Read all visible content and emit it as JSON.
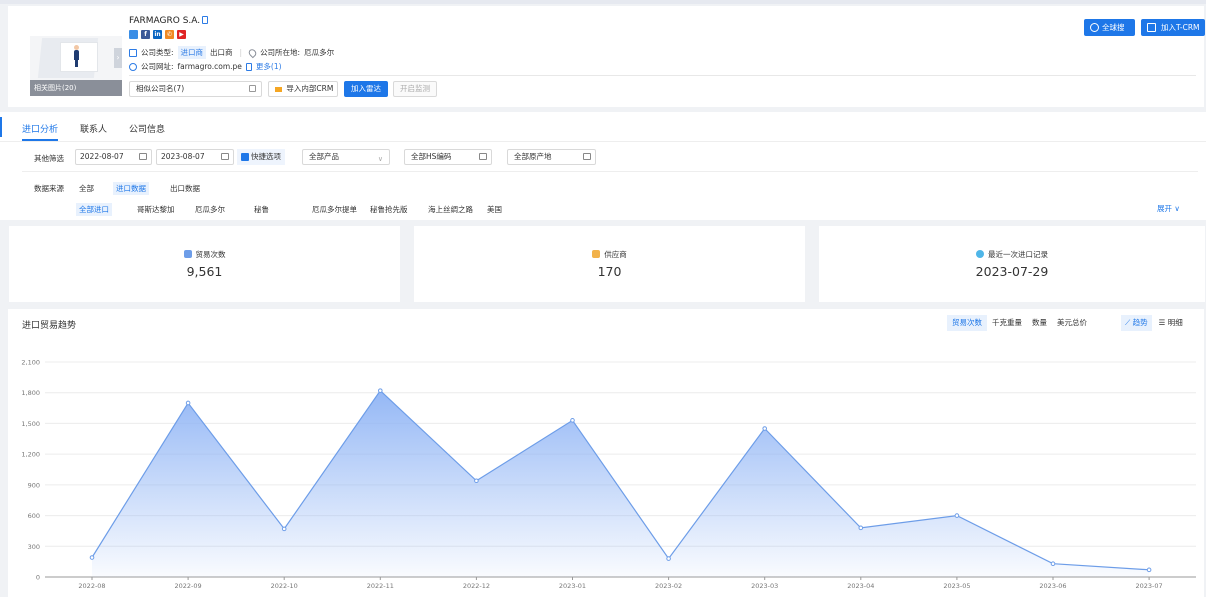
{
  "company": {
    "name": "FARMAGRO S.A.",
    "type_label": "公司类型:",
    "type_importer": "进口商",
    "type_exporter": "出口商",
    "location_label": "公司所在地:",
    "location": "厄瓜多尔",
    "website_label": "公司网址:",
    "website": "farmagro.com.pe",
    "more_link": "更多(1)",
    "pictures_label": "相关图片(20)",
    "social_icons": [
      "image-icon",
      "facebook-icon",
      "linkedin-icon",
      "phone-icon",
      "youtube-icon"
    ]
  },
  "header_actions": {
    "similar_companies": "相似公司名(7)",
    "import_crm": "导入内部CRM",
    "add_radar": "加入雷达",
    "start_monitor": "开启监测",
    "global_search": "全球搜",
    "add_tcrm": "加入T-CRM"
  },
  "tabs": [
    "进口分析",
    "联系人",
    "公司信息"
  ],
  "filters": {
    "other_label": "其他筛选",
    "date_start": "2022-08-07",
    "date_end": "2023-08-07",
    "quick_options": "快捷选项",
    "product": "全部产品",
    "hs_code": "全部HS编码",
    "origin": "全部原产地",
    "data_source_label": "数据来源",
    "sources": [
      "全部",
      "进口数据",
      "出口数据"
    ],
    "countries": [
      "全部进口",
      "哥斯达黎加",
      "厄瓜多尔",
      "秘鲁",
      "厄瓜多尔提单",
      "秘鲁抢先版",
      "海上丝绸之路",
      "美国"
    ],
    "expand": "展开"
  },
  "stats": [
    {
      "title": "贸易次数",
      "value": "9,561"
    },
    {
      "title": "供应商",
      "value": "170"
    },
    {
      "title": "最近一次进口记录",
      "value": "2023-07-29"
    }
  ],
  "chart_section": {
    "title": "进口贸易趋势",
    "metrics": [
      "贸易次数",
      "千克重量",
      "数量",
      "美元总价"
    ],
    "views": [
      "趋势",
      "明细"
    ]
  },
  "colors": {
    "accent": "#1e77e8",
    "line": "#6d9de8",
    "area_top": "#8fb4f5"
  },
  "chart_data": {
    "type": "area",
    "categories": [
      "2022-08",
      "2022-09",
      "2022-10",
      "2022-11",
      "2022-12",
      "2023-01",
      "2023-02",
      "2023-03",
      "2023-04",
      "2023-05",
      "2023-06",
      "2023-07"
    ],
    "series": [
      {
        "values": [
          190,
          1700,
          470,
          1820,
          940,
          1530,
          180,
          1450,
          480,
          600,
          130,
          70
        ]
      }
    ],
    "y_ticks": [
      "0",
      "300",
      "600",
      "900",
      "1,200",
      "1,500",
      "1,800",
      "2,100"
    ],
    "ylim": [
      0,
      2100
    ],
    "grid": true
  }
}
